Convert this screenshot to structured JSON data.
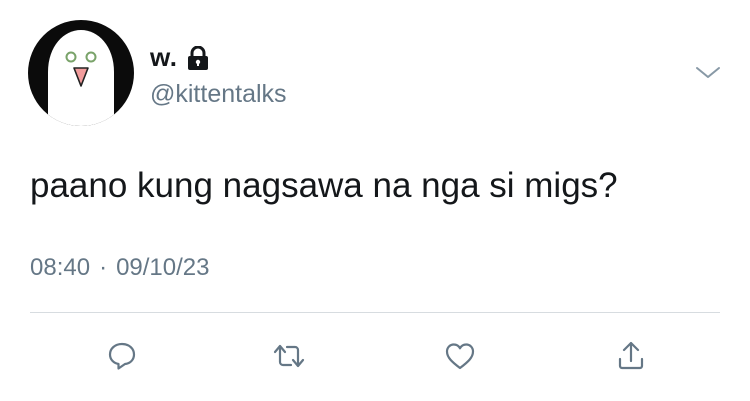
{
  "tweet": {
    "display_name": "w.",
    "handle": "@kittentalks",
    "text": "paano kung nagsawa na nga si migs?",
    "time": "08:40",
    "separator": "·",
    "date": "09/10/23"
  },
  "icons": {
    "lock": "lock-icon",
    "more": "chevron-down-icon",
    "reply": "reply-icon",
    "retweet": "retweet-icon",
    "like": "heart-icon",
    "share": "share-icon"
  },
  "colors": {
    "text_primary": "#14171a",
    "text_secondary": "#657786",
    "icon": "#657786",
    "divider": "#d7dce0",
    "avatar_bg": "#0b0b0b"
  }
}
